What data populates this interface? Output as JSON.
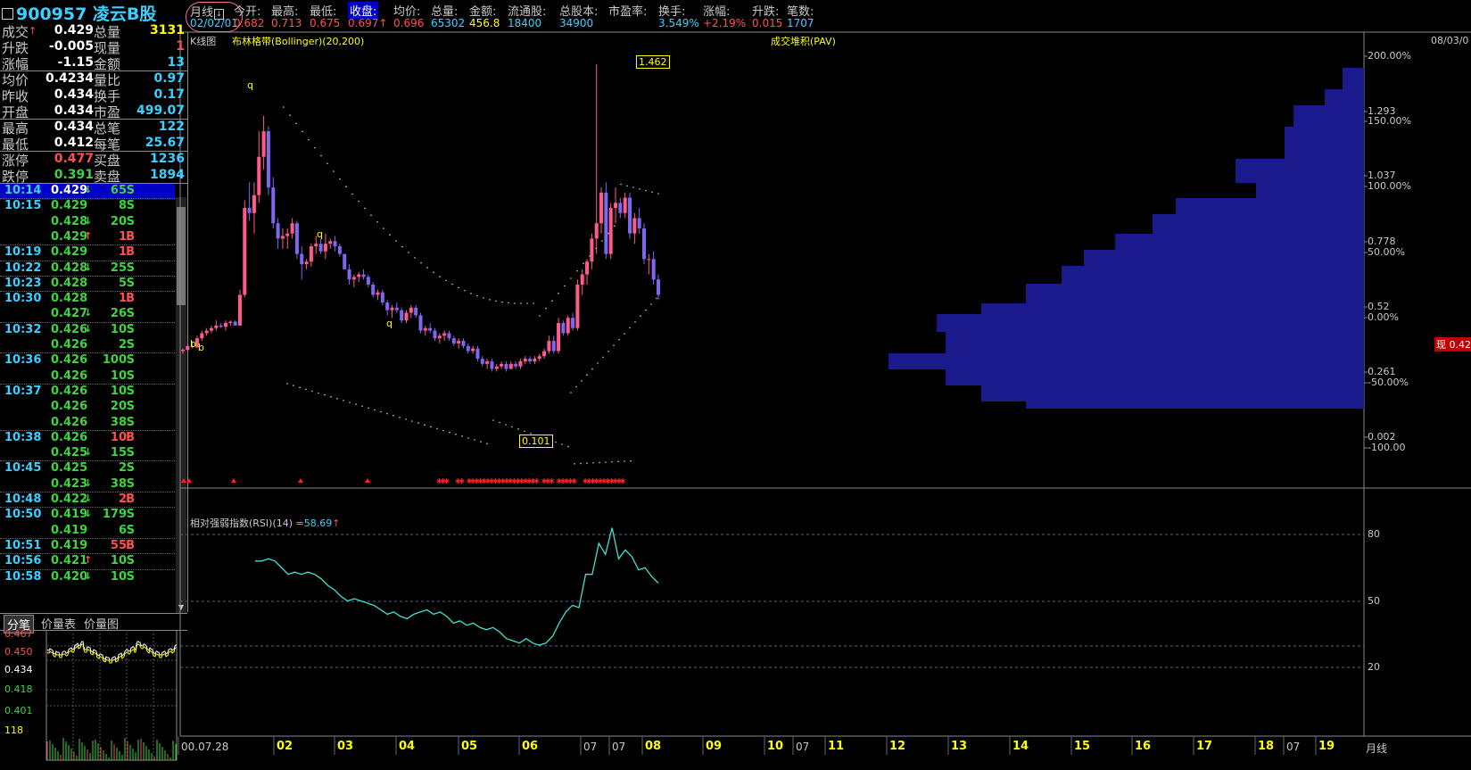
{
  "header": {
    "code_name": "900957 凌云B股",
    "period_label": "月线",
    "period_date": "02/02/01",
    "fields": [
      {
        "label": "今开:",
        "value": "0.682",
        "color": "#ff5050"
      },
      {
        "label": "最高:",
        "value": "0.713",
        "color": "#ff5050"
      },
      {
        "label": "最低:",
        "value": "0.675",
        "color": "#ff5050"
      },
      {
        "label": "收盘:",
        "value": "0.697",
        "color": "#ff5050",
        "arrow": "↑",
        "highlight": true
      },
      {
        "label": "均价:",
        "value": "0.696",
        "color": "#ff5050"
      },
      {
        "label": "总量:",
        "value": "65302",
        "color": "#3ad0ff"
      },
      {
        "label": "金额:",
        "value": "456.8",
        "color": "#ffff00"
      },
      {
        "label": "流通股:",
        "value": "18400",
        "color": "#3ad0ff"
      },
      {
        "label": "总股本:",
        "value": "34900",
        "color": "#3ad0ff"
      },
      {
        "label": "市盈率:",
        "value": "",
        "color": "#3ad0ff"
      },
      {
        "label": "换手:",
        "value": "3.549%",
        "color": "#3ad0ff"
      },
      {
        "label": "涨幅:",
        "value": "+2.19%",
        "color": "#ff5050"
      },
      {
        "label": "升跌:",
        "value": "0.015",
        "color": "#ff5050"
      },
      {
        "label": "笔数:",
        "value": "1707",
        "color": "#3ad0ff"
      }
    ]
  },
  "quote": [
    {
      "k1": "成交",
      "a1": "↑",
      "v1": "0.429",
      "c1": "#fff",
      "k2": "总量",
      "v2": "3131",
      "c2": "#ffff00"
    },
    {
      "k1": "升跌",
      "v1": "-0.005",
      "c1": "#fff",
      "k2": "现量",
      "v2": "1",
      "c2": "#ff5050"
    },
    {
      "k1": "涨幅",
      "v1": "-1.15",
      "c1": "#fff",
      "k2": "金额",
      "v2": "13",
      "c2": "#3ad0ff"
    },
    {
      "k1": "均价",
      "v1": "0.4234",
      "c1": "#fff",
      "k2": "量比",
      "v2": "0.97",
      "c2": "#3ad0ff"
    },
    {
      "k1": "昨收",
      "v1": "0.434",
      "c1": "#fff",
      "k2": "换手",
      "v2": "0.17",
      "c2": "#3ad0ff"
    },
    {
      "k1": "开盘",
      "v1": "0.434",
      "c1": "#fff",
      "k2": "市盈",
      "v2": "499.07",
      "c2": "#3ad0ff"
    },
    {
      "k1": "最高",
      "v1": "0.434",
      "c1": "#fff",
      "k2": "总笔",
      "v2": "122",
      "c2": "#3ad0ff"
    },
    {
      "k1": "最低",
      "v1": "0.412",
      "c1": "#fff",
      "k2": "每笔",
      "v2": "25.67",
      "c2": "#3ad0ff"
    },
    {
      "k1": "涨停",
      "v1": "0.477",
      "c1": "#ff5050",
      "k2": "买盘",
      "v2": "1236",
      "c2": "#3ad0ff"
    },
    {
      "k1": "跌停",
      "v1": "0.391",
      "c1": "#3fd33f",
      "k2": "卖盘",
      "v2": "1894",
      "c2": "#3ad0ff"
    }
  ],
  "ticks": [
    {
      "t": "10:14",
      "p": "0.429",
      "a": "↓",
      "s": "65",
      "d": "S"
    },
    {
      "t": "10:15",
      "p": "0.429",
      "a": "",
      "s": "8",
      "d": "S"
    },
    {
      "t": "",
      "p": "0.428",
      "a": "↓",
      "s": "20",
      "d": "S"
    },
    {
      "t": "",
      "p": "0.429",
      "a": "↑",
      "s": "1",
      "d": "B"
    },
    {
      "t": "10:19",
      "p": "0.429",
      "a": "",
      "s": "1",
      "d": "B"
    },
    {
      "t": "10:22",
      "p": "0.428",
      "a": "↓",
      "s": "25",
      "d": "S"
    },
    {
      "t": "10:23",
      "p": "0.428",
      "a": "",
      "s": "5",
      "d": "S"
    },
    {
      "t": "10:30",
      "p": "0.428",
      "a": "",
      "s": "1",
      "d": "B"
    },
    {
      "t": "",
      "p": "0.427",
      "a": "↓",
      "s": "26",
      "d": "S"
    },
    {
      "t": "10:32",
      "p": "0.426",
      "a": "↓",
      "s": "10",
      "d": "S"
    },
    {
      "t": "",
      "p": "0.426",
      "a": "",
      "s": "2",
      "d": "S"
    },
    {
      "t": "10:36",
      "p": "0.426",
      "a": "",
      "s": "100",
      "d": "S"
    },
    {
      "t": "",
      "p": "0.426",
      "a": "",
      "s": "10",
      "d": "S"
    },
    {
      "t": "10:37",
      "p": "0.426",
      "a": "",
      "s": "10",
      "d": "S"
    },
    {
      "t": "",
      "p": "0.426",
      "a": "",
      "s": "20",
      "d": "S"
    },
    {
      "t": "",
      "p": "0.426",
      "a": "",
      "s": "38",
      "d": "S"
    },
    {
      "t": "10:38",
      "p": "0.426",
      "a": "",
      "s": "10",
      "d": "B"
    },
    {
      "t": "",
      "p": "0.425",
      "a": "↓",
      "s": "15",
      "d": "S"
    },
    {
      "t": "10:45",
      "p": "0.425",
      "a": "",
      "s": "2",
      "d": "S"
    },
    {
      "t": "",
      "p": "0.423",
      "a": "↓",
      "s": "38",
      "d": "S"
    },
    {
      "t": "10:48",
      "p": "0.422",
      "a": "↓",
      "s": "2",
      "d": "B"
    },
    {
      "t": "10:50",
      "p": "0.419",
      "a": "↓",
      "s": "179",
      "d": "S"
    },
    {
      "t": "",
      "p": "0.419",
      "a": "",
      "s": "6",
      "d": "S"
    },
    {
      "t": "10:51",
      "p": "0.419",
      "a": "",
      "s": "55",
      "d": "B"
    },
    {
      "t": "10:56",
      "p": "0.421",
      "a": "↑",
      "s": "10",
      "d": "S"
    },
    {
      "t": "10:58",
      "p": "0.420",
      "a": "↓",
      "s": "10",
      "d": "S"
    }
  ],
  "tabs": [
    "分笔",
    "价量表",
    "价量图"
  ],
  "mini": {
    "y_labels": [
      "0.467",
      "0.450",
      "0.434",
      "0.418",
      "0.401",
      "118"
    ]
  },
  "kline": {
    "title": "K线图",
    "indicator": "布林格带(Bollinger)(20,200)",
    "pav_title": "成交堆积(PAV)",
    "max_label": "1.462",
    "min_label": "0.101",
    "marks": [
      "b",
      "b",
      "q",
      "q",
      "q"
    ]
  },
  "rsi": {
    "title": "相对强弱指数(RSI)(14)",
    "value": "=58.69",
    "arrow": "↑",
    "levels": [
      "80",
      "50",
      "20"
    ]
  },
  "right_axis": {
    "date": "08/03/0",
    "price_labels": [
      {
        "v": "200.00%"
      },
      {
        "v": "1.293"
      },
      {
        "v": "150.00%"
      },
      {
        "v": "1.037"
      },
      {
        "v": "100.00%"
      },
      {
        "v": "0.778"
      },
      {
        "v": "50.00%"
      },
      {
        "v": "0.52"
      },
      {
        "v": "0.00%"
      },
      {
        "v": "0.261"
      },
      {
        "v": "-50.00%"
      },
      {
        "v": "0.002"
      },
      {
        "v": "-100.00"
      }
    ],
    "current_price": "现 0.429"
  },
  "x_axis": {
    "labels": [
      "00.07.28",
      "02",
      "03",
      "04",
      "05",
      "06",
      "07",
      "07",
      "08",
      "09",
      "10",
      "07",
      "11",
      "12",
      "13",
      "14",
      "15",
      "16",
      "17",
      "18",
      "07",
      "19"
    ],
    "period": "月线"
  },
  "chart_data": {
    "type": "candlestick",
    "price_range": [
      0.002,
      1.55
    ],
    "candles": [
      [
        0.34,
        0.35,
        0.33,
        0.345
      ],
      [
        0.345,
        0.37,
        0.34,
        0.36
      ],
      [
        0.36,
        0.38,
        0.35,
        0.355
      ],
      [
        0.355,
        0.4,
        0.35,
        0.39
      ],
      [
        0.39,
        0.42,
        0.38,
        0.41
      ],
      [
        0.41,
        0.43,
        0.4,
        0.42
      ],
      [
        0.42,
        0.44,
        0.41,
        0.43
      ],
      [
        0.43,
        0.46,
        0.42,
        0.44
      ],
      [
        0.44,
        0.45,
        0.43,
        0.435
      ],
      [
        0.435,
        0.46,
        0.42,
        0.45
      ],
      [
        0.45,
        0.46,
        0.44,
        0.455
      ],
      [
        0.455,
        0.46,
        0.44,
        0.44
      ],
      [
        0.44,
        0.58,
        0.44,
        0.56
      ],
      [
        0.56,
        0.93,
        0.55,
        0.9
      ],
      [
        0.9,
        1.0,
        0.85,
        0.88
      ],
      [
        0.88,
        1.0,
        0.8,
        0.95
      ],
      [
        0.95,
        1.2,
        0.92,
        1.1
      ],
      [
        1.1,
        1.26,
        1.05,
        1.2
      ],
      [
        1.2,
        1.22,
        0.95,
        0.98
      ],
      [
        0.98,
        1.02,
        0.82,
        0.84
      ],
      [
        0.84,
        0.86,
        0.74,
        0.78
      ],
      [
        0.78,
        0.82,
        0.74,
        0.79
      ],
      [
        0.79,
        0.82,
        0.74,
        0.8
      ],
      [
        0.8,
        0.86,
        0.78,
        0.84
      ],
      [
        0.84,
        0.85,
        0.7,
        0.72
      ],
      [
        0.72,
        0.75,
        0.62,
        0.68
      ],
      [
        0.68,
        0.7,
        0.66,
        0.69
      ],
      [
        0.69,
        0.76,
        0.67,
        0.75
      ],
      [
        0.75,
        0.79,
        0.72,
        0.76
      ],
      [
        0.76,
        0.78,
        0.72,
        0.73
      ],
      [
        0.73,
        0.8,
        0.7,
        0.76
      ],
      [
        0.76,
        0.78,
        0.74,
        0.77
      ],
      [
        0.77,
        0.79,
        0.73,
        0.75
      ],
      [
        0.75,
        0.76,
        0.71,
        0.72
      ],
      [
        0.72,
        0.72,
        0.66,
        0.66
      ],
      [
        0.66,
        0.68,
        0.6,
        0.62
      ],
      [
        0.62,
        0.64,
        0.59,
        0.63
      ],
      [
        0.63,
        0.65,
        0.61,
        0.64
      ],
      [
        0.64,
        0.66,
        0.62,
        0.63
      ],
      [
        0.63,
        0.64,
        0.59,
        0.6
      ],
      [
        0.6,
        0.61,
        0.55,
        0.56
      ],
      [
        0.56,
        0.58,
        0.54,
        0.57
      ],
      [
        0.57,
        0.58,
        0.52,
        0.53
      ],
      [
        0.53,
        0.54,
        0.48,
        0.5
      ],
      [
        0.5,
        0.52,
        0.47,
        0.51
      ],
      [
        0.51,
        0.53,
        0.49,
        0.5
      ],
      [
        0.5,
        0.51,
        0.45,
        0.46
      ],
      [
        0.46,
        0.5,
        0.45,
        0.49
      ],
      [
        0.49,
        0.52,
        0.47,
        0.51
      ],
      [
        0.51,
        0.52,
        0.47,
        0.48
      ],
      [
        0.48,
        0.49,
        0.41,
        0.42
      ],
      [
        0.42,
        0.44,
        0.4,
        0.43
      ],
      [
        0.43,
        0.45,
        0.41,
        0.42
      ],
      [
        0.42,
        0.43,
        0.38,
        0.39
      ],
      [
        0.39,
        0.41,
        0.37,
        0.4
      ],
      [
        0.4,
        0.42,
        0.38,
        0.41
      ],
      [
        0.41,
        0.42,
        0.38,
        0.39
      ],
      [
        0.39,
        0.4,
        0.36,
        0.37
      ],
      [
        0.37,
        0.39,
        0.35,
        0.38
      ],
      [
        0.38,
        0.39,
        0.35,
        0.36
      ],
      [
        0.36,
        0.37,
        0.33,
        0.34
      ],
      [
        0.34,
        0.36,
        0.33,
        0.35
      ],
      [
        0.35,
        0.36,
        0.3,
        0.31
      ],
      [
        0.31,
        0.32,
        0.28,
        0.29
      ],
      [
        0.29,
        0.31,
        0.27,
        0.3
      ],
      [
        0.3,
        0.31,
        0.26,
        0.27
      ],
      [
        0.27,
        0.29,
        0.26,
        0.28
      ],
      [
        0.28,
        0.3,
        0.27,
        0.29
      ],
      [
        0.29,
        0.3,
        0.26,
        0.27
      ],
      [
        0.27,
        0.3,
        0.27,
        0.29
      ],
      [
        0.29,
        0.3,
        0.27,
        0.28
      ],
      [
        0.28,
        0.31,
        0.27,
        0.3
      ],
      [
        0.3,
        0.32,
        0.29,
        0.31
      ],
      [
        0.31,
        0.32,
        0.29,
        0.3
      ],
      [
        0.3,
        0.32,
        0.29,
        0.31
      ],
      [
        0.31,
        0.33,
        0.3,
        0.32
      ],
      [
        0.32,
        0.35,
        0.31,
        0.34
      ],
      [
        0.34,
        0.4,
        0.33,
        0.38
      ],
      [
        0.38,
        0.4,
        0.33,
        0.34
      ],
      [
        0.34,
        0.47,
        0.33,
        0.45
      ],
      [
        0.45,
        0.46,
        0.4,
        0.41
      ],
      [
        0.41,
        0.48,
        0.4,
        0.47
      ],
      [
        0.47,
        0.49,
        0.42,
        0.43
      ],
      [
        0.43,
        0.62,
        0.42,
        0.6
      ],
      [
        0.6,
        0.66,
        0.56,
        0.64
      ],
      [
        0.64,
        0.7,
        0.6,
        0.69
      ],
      [
        0.69,
        0.8,
        0.66,
        0.78
      ],
      [
        0.78,
        1.462,
        0.72,
        0.84
      ],
      [
        0.84,
        0.98,
        0.8,
        0.96
      ],
      [
        0.96,
        1.0,
        0.7,
        0.72
      ],
      [
        0.72,
        0.92,
        0.7,
        0.9
      ],
      [
        0.9,
        0.98,
        0.84,
        0.92
      ],
      [
        0.92,
        0.94,
        0.86,
        0.88
      ],
      [
        0.88,
        0.96,
        0.86,
        0.94
      ],
      [
        0.94,
        0.96,
        0.78,
        0.8
      ],
      [
        0.8,
        0.88,
        0.76,
        0.86
      ],
      [
        0.86,
        0.9,
        0.8,
        0.82
      ],
      [
        0.82,
        0.84,
        0.68,
        0.7
      ],
      [
        0.7,
        0.72,
        0.64,
        0.7
      ],
      [
        0.7,
        0.73,
        0.6,
        0.62
      ],
      [
        0.62,
        0.64,
        0.54,
        0.56
      ]
    ],
    "rsi": [
      68,
      68,
      69,
      68,
      65,
      62,
      63,
      62,
      63,
      62,
      60,
      57,
      55,
      52,
      50,
      51,
      50,
      49,
      48,
      46,
      44,
      45,
      43,
      42,
      44,
      45,
      46,
      44,
      45,
      43,
      40,
      41,
      39,
      40,
      38,
      37,
      38,
      36,
      33,
      32,
      31,
      33,
      31,
      30,
      31,
      34,
      40,
      45,
      48,
      47,
      62,
      62,
      76,
      71,
      83,
      69,
      73,
      70,
      64,
      65,
      61,
      58
    ]
  }
}
